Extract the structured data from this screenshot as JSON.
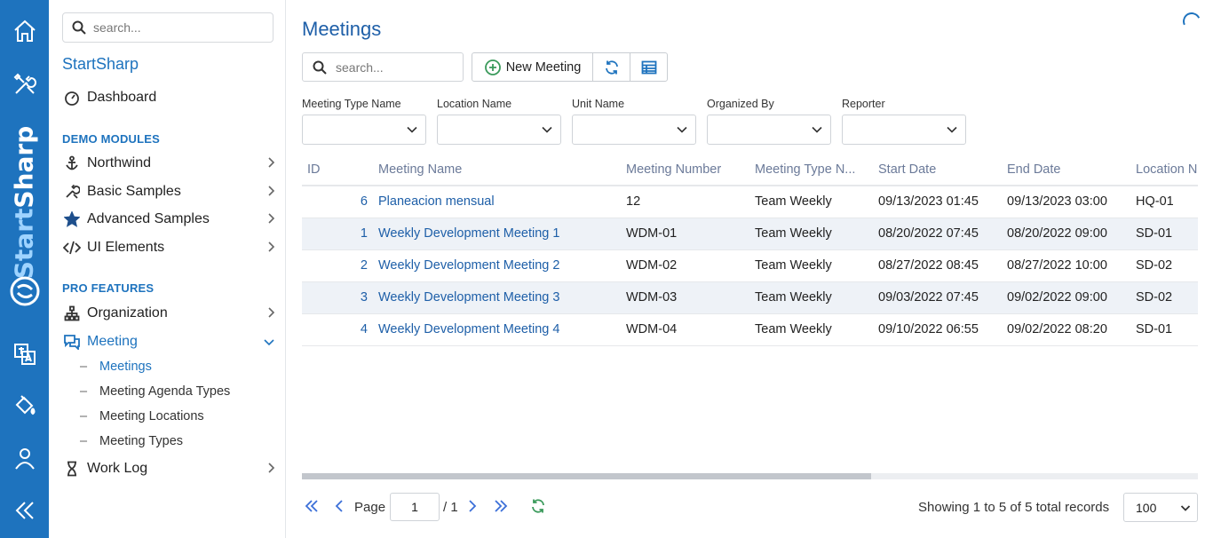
{
  "brand": {
    "vertical_start": "Start",
    "vertical_end": "Sharp"
  },
  "sidebar": {
    "search_placeholder": "search...",
    "app_title": "StartSharp",
    "dashboard": "Dashboard",
    "demo_section": "DEMO MODULES",
    "demo_items": [
      "Northwind",
      "Basic Samples",
      "Advanced Samples",
      "UI Elements"
    ],
    "pro_section": "PRO FEATURES",
    "organization": "Organization",
    "meeting": "Meeting",
    "meeting_sub": [
      "Meetings",
      "Meeting Agenda Types",
      "Meeting Locations",
      "Meeting Types"
    ],
    "work_log": "Work Log"
  },
  "page": {
    "title": "Meetings"
  },
  "toolbar": {
    "search_placeholder": "search...",
    "new_meeting": "New Meeting"
  },
  "filters": [
    "Meeting Type Name",
    "Location Name",
    "Unit Name",
    "Organized By",
    "Reporter"
  ],
  "grid": {
    "columns": [
      "ID",
      "Meeting Name",
      "Meeting Number",
      "Meeting Type N...",
      "Start Date",
      "End Date",
      "Location N"
    ],
    "rows": [
      [
        "6",
        "Planeacion mensual",
        "12",
        "Team Weekly",
        "09/13/2023 01:45",
        "09/13/2023 03:00",
        "HQ-01"
      ],
      [
        "1",
        "Weekly Development Meeting 1",
        "WDM-01",
        "Team Weekly",
        "08/20/2022 07:45",
        "08/20/2022 09:00",
        "SD-01"
      ],
      [
        "2",
        "Weekly Development Meeting 2",
        "WDM-02",
        "Team Weekly",
        "08/27/2022 08:45",
        "08/27/2022 10:00",
        "SD-02"
      ],
      [
        "3",
        "Weekly Development Meeting 3",
        "WDM-03",
        "Team Weekly",
        "09/03/2022 07:45",
        "09/02/2022 09:00",
        "SD-02"
      ],
      [
        "4",
        "Weekly Development Meeting 4",
        "WDM-04",
        "Team Weekly",
        "09/10/2022 06:55",
        "09/02/2022 08:20",
        "SD-01"
      ]
    ]
  },
  "pager": {
    "page_label": "Page",
    "page_value": "1",
    "page_of": "/ 1",
    "status": "Showing 1 to 5 of 5 total records",
    "page_size": "100"
  },
  "colors": {
    "brand_blue": "#1e73be",
    "link_blue": "#1e5fa8",
    "alt_row": "#eef2f7"
  }
}
